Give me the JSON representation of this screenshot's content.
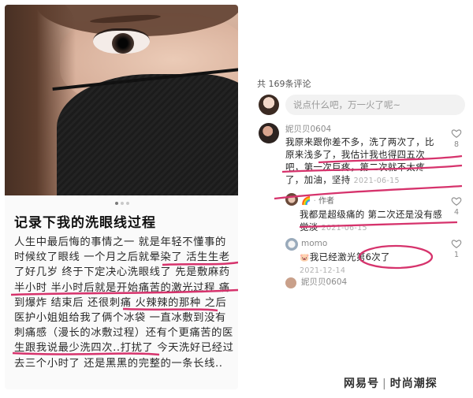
{
  "post": {
    "title": "记录下我的洗眼线过程",
    "body": "人生中最后悔的事情之一 就是年轻不懂事的时候纹了眼线 一个月之后就晕染了 活生生老了好几岁 终于下定决心洗眼线了 先是敷麻药半小时 半小时后就是开始痛苦的激光过程 痛到爆炸 结束后 还很刺痛 火辣辣的那种 之后医护小姐姐给我了俩个冰袋 一直冰敷到没有刺痛感（漫长的冰敷过程）还有个更痛苦的医生跟我说最少洗四次..打扰了 今天洗好已经过去三个小时了 还是黑黑的完整的一条长线.."
  },
  "comments": {
    "count_label": "共 169条评论",
    "input_placeholder": "说点什么吧，万一火了呢~",
    "items": [
      {
        "user": "妮贝贝0604",
        "text": "我原来跟你差不多，洗了两次了，比原来浅多了，我估计我也得四五次吧，第一次巨疼，第二次就不太疼了，加油，坚持",
        "date": "2021-06-15",
        "likes": "8"
      },
      {
        "user": "作者",
        "text": "我都是超级痛的 第二次还是没有感觉淡",
        "date": "2021-06-15",
        "likes": "4"
      },
      {
        "user": "momo",
        "text": "我已经激光第6次了",
        "date": "2021-12-14",
        "likes": "1"
      },
      {
        "user": "妮贝贝0604"
      }
    ]
  },
  "watermark": {
    "brand": "网易号",
    "channel": "时尚潮探"
  },
  "colors": {
    "annotation": "#d6336c"
  }
}
